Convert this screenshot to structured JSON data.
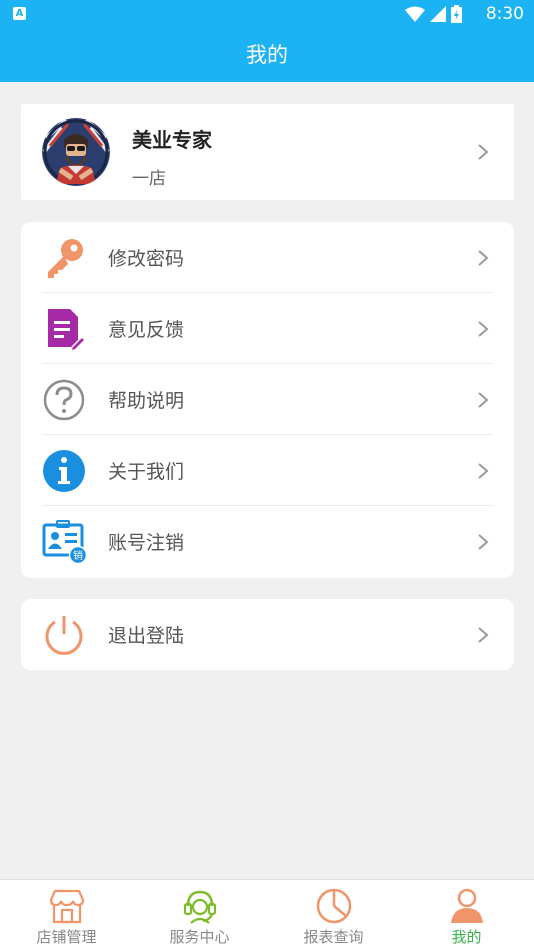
{
  "status_bar": {
    "time": "8:30",
    "notification_icon": "A"
  },
  "header": {
    "title": "我的"
  },
  "profile": {
    "name": "美业专家",
    "store": "一店"
  },
  "menu": [
    {
      "label": "修改密码",
      "icon": "key-icon",
      "color": "#f0956a"
    },
    {
      "label": "意见反馈",
      "icon": "feedback-icon",
      "color": "#a62aa6"
    },
    {
      "label": "帮助说明",
      "icon": "help-icon",
      "color": "#8c8c8c"
    },
    {
      "label": "关于我们",
      "icon": "info-icon",
      "color": "#1a8fe0"
    },
    {
      "label": "账号注销",
      "icon": "account-cancel-icon",
      "color": "#1a8fe0",
      "badge": "销"
    }
  ],
  "logout": {
    "label": "退出登陆",
    "icon": "power-icon",
    "color": "#f0956a"
  },
  "bottom_nav": [
    {
      "label": "店铺管理",
      "icon": "store-icon"
    },
    {
      "label": "服务中心",
      "icon": "service-icon"
    },
    {
      "label": "报表查询",
      "icon": "report-icon"
    },
    {
      "label": "我的",
      "icon": "profile-icon",
      "active": true
    }
  ],
  "colors": {
    "primary": "#1cb3f4",
    "active_tab": "#38b349"
  }
}
